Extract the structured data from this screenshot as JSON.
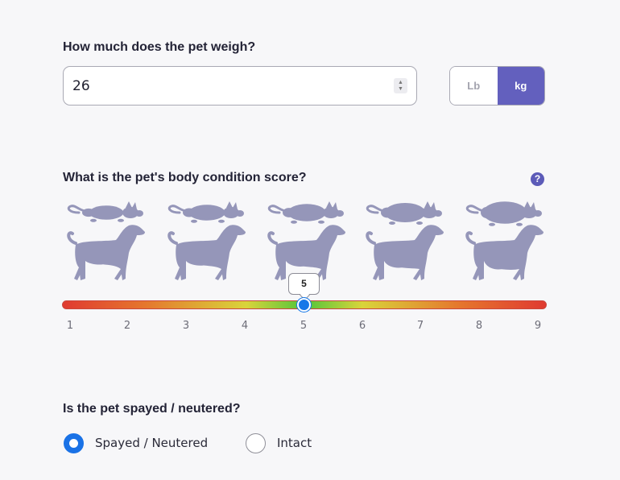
{
  "weight": {
    "question": "How much does the pet weigh?",
    "value": "26",
    "units": {
      "lb": "Lb",
      "kg": "kg",
      "selected": "kg"
    }
  },
  "bcs": {
    "question": "What is the pet's body condition score?",
    "help_icon": "question-circle-icon",
    "value": "5",
    "min": 1,
    "max": 9,
    "ticks": [
      "1",
      "2",
      "3",
      "4",
      "5",
      "6",
      "7",
      "8",
      "9"
    ],
    "pet_icons": [
      "cat-silhouette-icon",
      "dog-silhouette-icon"
    ]
  },
  "spay": {
    "question": "Is the pet spayed / neutered?",
    "options": [
      "Spayed / Neutered",
      "Intact"
    ],
    "selected": "Spayed / Neutered"
  },
  "colors": {
    "accent": "#6360be",
    "radio_checked": "#1a72e6",
    "silhouette": "#9596b9"
  }
}
